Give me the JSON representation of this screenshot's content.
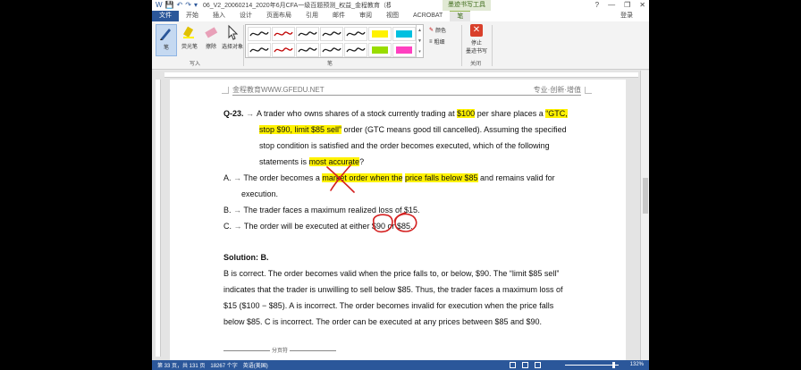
{
  "window": {
    "title": "06_V2_20060214_2020年6月CFA一级百题预测_权益_金程教育（模...",
    "context_tab_group": "墨迹书写工具",
    "login": "登录",
    "controls": [
      "?",
      "—",
      "❐",
      "✕"
    ]
  },
  "quick_access": [
    "W",
    "💾",
    "↶",
    "↷",
    "▾"
  ],
  "tabs": [
    "文件",
    "开始",
    "插入",
    "设计",
    "页面布局",
    "引用",
    "邮件",
    "审阅",
    "视图",
    "ACROBAT",
    "笔"
  ],
  "ribbon": {
    "write_group": {
      "label": "写入",
      "buttons": [
        {
          "label": "笔",
          "icon": "pen-icon"
        },
        {
          "label": "荧光笔",
          "icon": "highlighter-icon"
        },
        {
          "label": "擦除",
          "icon": "eraser-icon"
        },
        {
          "label": "选择对象",
          "icon": "select-objects-icon"
        }
      ]
    },
    "pens_group": {
      "label": "笔",
      "pen_colors": [
        "#1a1a1a",
        "#c00000",
        "#1a1a1a",
        "#1a1a1a",
        "#1a1a1a",
        "#fff200",
        "#00c0e0",
        "#1a1a1a",
        "#c00000",
        "#1a1a1a",
        "#1a1a1a",
        "#1a1a1a",
        "#99dd00",
        "#ff40c0"
      ]
    },
    "color_option": "颜色",
    "thickness_option": "粗细",
    "close_group": {
      "label": "关闭",
      "stop_inking": "停止\n墨迹书写"
    }
  },
  "document": {
    "header_left": "金程教育WWW.GFEDU.NET",
    "header_right": "专业·创新·增值",
    "question": {
      "number": "Q-23.",
      "line1_a": "A trader who owns shares of a stock currently trading at ",
      "line1_hl1": "$100",
      "line1_b": " per share places a ",
      "line1_hl2": "“GTC,",
      "line2_hl": "stop $90, limit $85 sell”",
      "line2_b": " order (GTC means good till cancelled). Assuming the specified",
      "line3": "stop condition is satisfied and the order becomes executed, which of the following",
      "line4_a": "statements is ",
      "line4_hl": "most accurate",
      "line4_b": "?"
    },
    "options": {
      "a_prefix": "A.",
      "a_text1": "The order becomes a ",
      "a_hl1": "market order when the",
      "a_mid": " ",
      "a_hl2": "price falls below $85",
      "a_text2": " and remains valid for",
      "a_line2": "execution.",
      "b_prefix": "B.",
      "b_text": "The trader faces a maximum realized loss of $15.",
      "c_prefix": "C.",
      "c_text": "The order will be executed at either $90 or $85."
    },
    "solution": {
      "heading": "Solution: B.",
      "l1": "B is correct. The order becomes valid when the price falls to, or below, $90. The “limit $85 sell”",
      "l2": "indicates that the trader is unwilling to sell below $85. Thus, the trader faces a maximum loss of",
      "l3": "$15 ($100 − $85). A is incorrect. The order becomes invalid for execution when the price falls",
      "l4": "below $85. C is incorrect. The order can be executed at any prices between $85 and $90."
    },
    "page_break": "分页符"
  },
  "status_bar": {
    "page": "第 33 页，共 131 页",
    "words": "18267 个字",
    "language": "英语(美国)",
    "zoom": "132%"
  }
}
